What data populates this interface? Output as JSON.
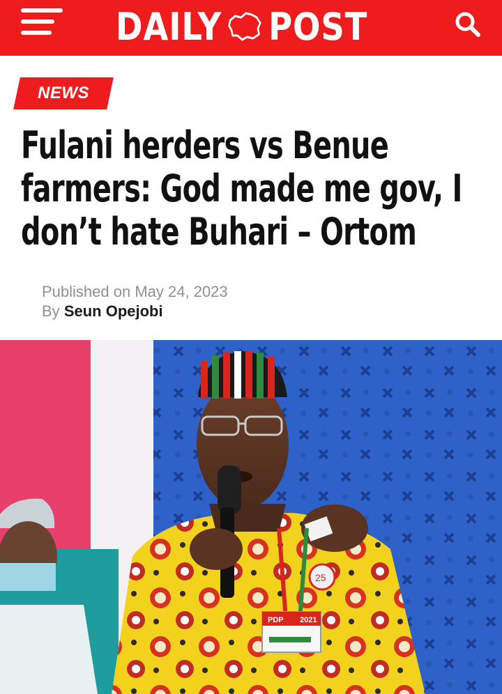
{
  "header": {
    "logo_left": "DAILY",
    "logo_right": "POST",
    "menu_icon": "hamburger-menu-icon",
    "search_icon": "search-icon",
    "brand_color": "#ee1c1c"
  },
  "article": {
    "category": "NEWS",
    "headline_lines": [
      "Fulani herders vs Benue",
      "farmers: God made me gov, I",
      "don’t hate Buhari – Ortom"
    ],
    "published_label": "Published on",
    "published_date": "May 24, 2023",
    "by_label": "By",
    "author": "Seun Opejobi"
  },
  "image": {
    "badge_top": "PDP",
    "badge_year": "2021",
    "rosette_number": "25"
  }
}
